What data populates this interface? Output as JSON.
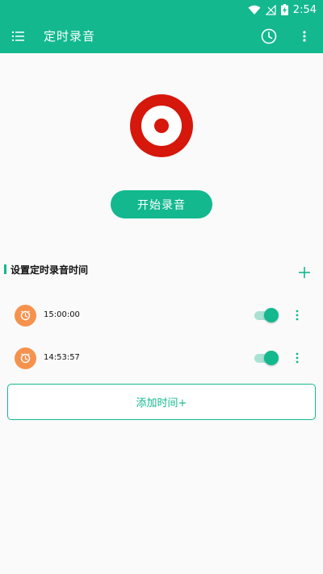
{
  "status": {
    "time": "2:54"
  },
  "appbar": {
    "title": "定时录音"
  },
  "main": {
    "start_label": "开始录音"
  },
  "section": {
    "title": "设置定时录音时间"
  },
  "schedules": [
    {
      "time": "15:00:00",
      "enabled": true
    },
    {
      "time": "14:53:57",
      "enabled": true
    }
  ],
  "add_time_label": "添加时间+",
  "colors": {
    "accent": "#13b88f",
    "record": "#d6170b",
    "clock_badge": "#f6924e"
  }
}
